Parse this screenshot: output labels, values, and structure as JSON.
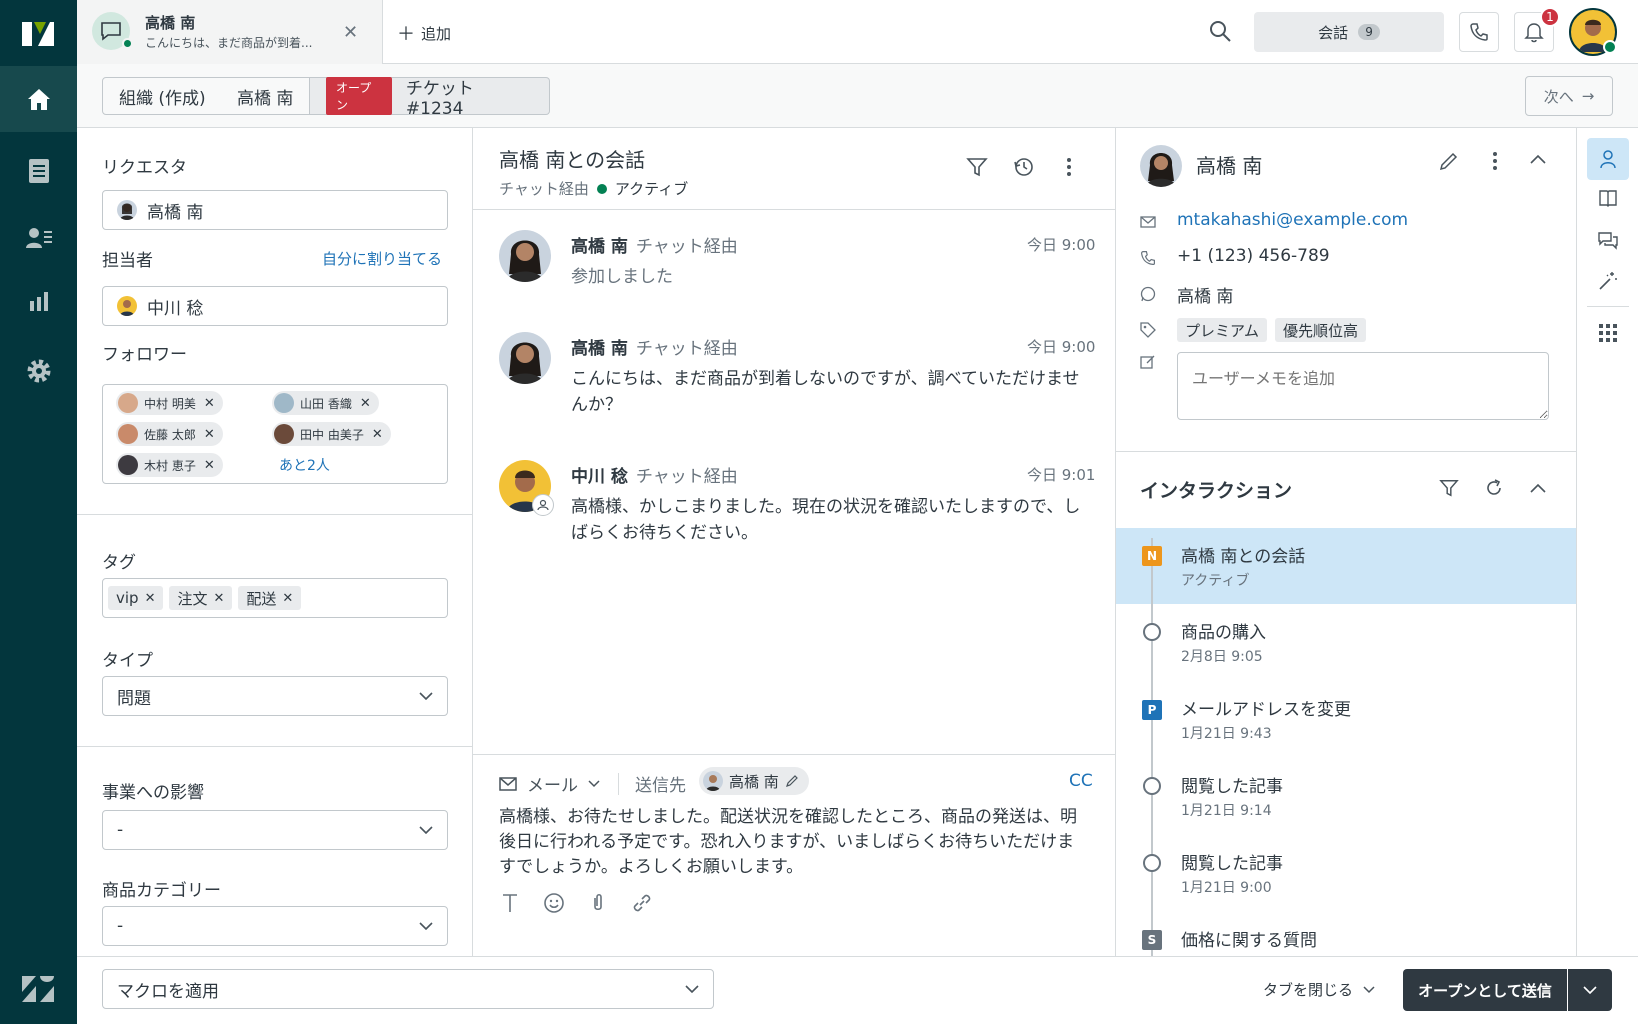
{
  "topbar": {
    "tab": {
      "name": "高橋 南",
      "preview": "こんにちは、まだ商品が到着..."
    },
    "add_label": "追加",
    "conversations_label": "会話",
    "conversations_count": "9",
    "notifications_count": "1"
  },
  "breadcrumb": {
    "org": "組織 (作成)",
    "user": "高橋 南",
    "status": "オープン",
    "ticket": "チケット #1234",
    "next": "次へ"
  },
  "left": {
    "requester_label": "リクエスタ",
    "requester": "高橋 南",
    "assignee_label": "担当者",
    "assign_self": "自分に割り当てる",
    "assignee": "中川 稔",
    "followers_label": "フォロワー",
    "followers": [
      "中村 明美",
      "山田 香織",
      "佐藤 太郎",
      "田中 由美子",
      "木村 恵子"
    ],
    "followers_more": "あと2人",
    "tags_label": "タグ",
    "tags": [
      "vip",
      "注文",
      "配送"
    ],
    "type_label": "タイプ",
    "type_value": "問題",
    "impact_label": "事業への影響",
    "impact_value": "-",
    "category_label": "商品カテゴリー",
    "category_value": "-"
  },
  "conversation": {
    "title": "高橋 南との会話",
    "via": "チャット経由",
    "status": "アクティブ",
    "messages": [
      {
        "name": "高橋 南",
        "via": "チャット経由",
        "time": "今日 9:00",
        "text": "参加しました"
      },
      {
        "name": "高橋 南",
        "via": "チャット経由",
        "time": "今日 9:00",
        "text": "こんにちは、まだ商品が到着しないのですが、調べていただけませんか？"
      },
      {
        "name": "中川 稔",
        "via": "チャット経由",
        "time": "今日 9:01",
        "text": "高橋様、かしこまりました。現在の状況を確認いたしますので、しばらくお待ちください。"
      }
    ]
  },
  "composer": {
    "channel": "メール",
    "to_label": "送信先",
    "to": "高橋 南",
    "cc": "CC",
    "text": "高橋様、お待たせしました。配送状況を確認したところ、商品の発送は、明後日に行われる予定です。恐れ入りますが、いましばらくお待ちいただけますでしょうか。よろしくお願いします。"
  },
  "profile": {
    "name": "高橋 南",
    "email": "mtakahashi@example.com",
    "phone": "+1 (123) 456-789",
    "whatsapp": "高橋 南",
    "tags": [
      "プレミアム",
      "優先順位高"
    ],
    "note_placeholder": "ユーザーメモを追加"
  },
  "interactions": {
    "title": "インタラクション",
    "items": [
      {
        "badge": "N",
        "title": "高橋 南との会話",
        "sub": "アクティブ"
      },
      {
        "badge": "",
        "title": "商品の購入",
        "sub": "2月8日 9:05"
      },
      {
        "badge": "P",
        "title": "メールアドレスを変更",
        "sub": "1月21日 9:43"
      },
      {
        "badge": "",
        "title": "閲覧した記事",
        "sub": "1月21日 9:14"
      },
      {
        "badge": "",
        "title": "閲覧した記事",
        "sub": "1月21日 9:00"
      },
      {
        "badge": "S",
        "title": "価格に関する質問",
        "sub": ""
      }
    ]
  },
  "bottom": {
    "macro": "マクロを適用",
    "close_tab": "タブを閉じる",
    "submit": "オープンとして送信"
  },
  "colors": {
    "nav": "#03363d",
    "accent": "#1f73b7",
    "status_red": "#cc3340",
    "active_green": "#038153",
    "highlight": "#cde6f7"
  }
}
